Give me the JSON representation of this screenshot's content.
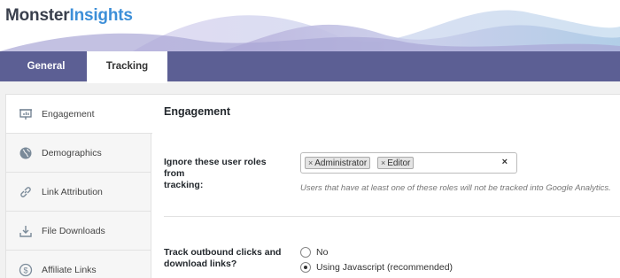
{
  "brand": {
    "part1": "Monster",
    "part2": "Insights"
  },
  "tabs": [
    {
      "label": "General",
      "active": false
    },
    {
      "label": "Tracking",
      "active": true
    }
  ],
  "sidebar": {
    "items": [
      {
        "label": "Engagement",
        "icon": "presentation-chart-icon",
        "active": true
      },
      {
        "label": "Demographics",
        "icon": "globe-icon",
        "active": false
      },
      {
        "label": "Link Attribution",
        "icon": "link-icon",
        "active": false
      },
      {
        "label": "File Downloads",
        "icon": "download-icon",
        "active": false
      },
      {
        "label": "Affiliate Links",
        "icon": "dollar-icon",
        "active": false
      }
    ]
  },
  "main": {
    "section_title": "Engagement",
    "ignore_roles": {
      "label_line1": "Ignore these user roles from",
      "label_line2": "tracking:",
      "tags": [
        "Administrator",
        "Editor"
      ],
      "clear_symbol": "×",
      "hint": "Users that have at least one of these roles will not be tracked into Google Analytics."
    },
    "outbound": {
      "label_line1": "Track outbound clicks and",
      "label_line2": "download links?",
      "options": [
        {
          "label": "No",
          "checked": false
        },
        {
          "label": "Using Javascript (recommended)",
          "checked": true
        }
      ]
    }
  },
  "colors": {
    "tabbar": "#5c5f94",
    "brand_dark": "#393f4c",
    "brand_blue": "#3d8fd8"
  }
}
